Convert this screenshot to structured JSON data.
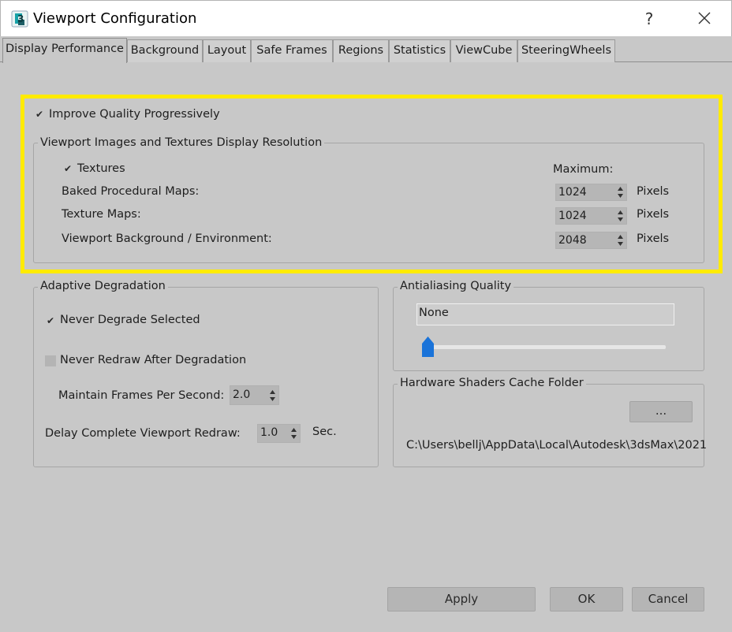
{
  "window": {
    "title": "Viewport Configuration",
    "help_label": "?",
    "close_icon": "close-icon",
    "app_icon": "3ds-max-icon"
  },
  "tabs": [
    {
      "label": "Display Performance",
      "active": true
    },
    {
      "label": "Background"
    },
    {
      "label": "Layout"
    },
    {
      "label": "Safe Frames"
    },
    {
      "label": "Regions"
    },
    {
      "label": "Statistics"
    },
    {
      "label": "ViewCube"
    },
    {
      "label": "SteeringWheels"
    }
  ],
  "quality": {
    "improve_label": "Improve Quality Progressively",
    "improve_checked": true
  },
  "resolution": {
    "group_title": "Viewport Images and Textures Display Resolution",
    "textures_label": "Textures",
    "textures_checked": true,
    "maximum_label": "Maximum:",
    "rows": [
      {
        "label": "Baked Procedural Maps:",
        "value": "1024",
        "units": "Pixels"
      },
      {
        "label": "Texture Maps:",
        "value": "1024",
        "units": "Pixels"
      },
      {
        "label": "Viewport Background / Environment:",
        "value": "2048",
        "units": "Pixels"
      }
    ]
  },
  "degradation": {
    "group_title": "Adaptive Degradation",
    "never_degrade_label": "Never Degrade Selected",
    "never_degrade_checked": true,
    "never_redraw_label": "Never Redraw After Degradation",
    "never_redraw_checked": false,
    "fps_label": "Maintain Frames Per Second:",
    "fps_value": "2.0",
    "delay_label": "Delay Complete Viewport Redraw:",
    "delay_value": "1.0",
    "delay_units": "Sec."
  },
  "antialiasing": {
    "group_title": "Antialiasing Quality",
    "value": "None",
    "slider_level": 0
  },
  "shaders": {
    "group_title": "Hardware Shaders Cache Folder",
    "browse_label": "...",
    "path": "C:\\Users\\bellj\\AppData\\Local\\Autodesk\\3dsMax\\2021"
  },
  "buttons": {
    "apply": "Apply",
    "ok": "OK",
    "cancel": "Cancel"
  },
  "colors": {
    "highlight": "#ffeb00",
    "slider_thumb": "#1a73d9",
    "dialog_bg": "#c8c8c8"
  }
}
